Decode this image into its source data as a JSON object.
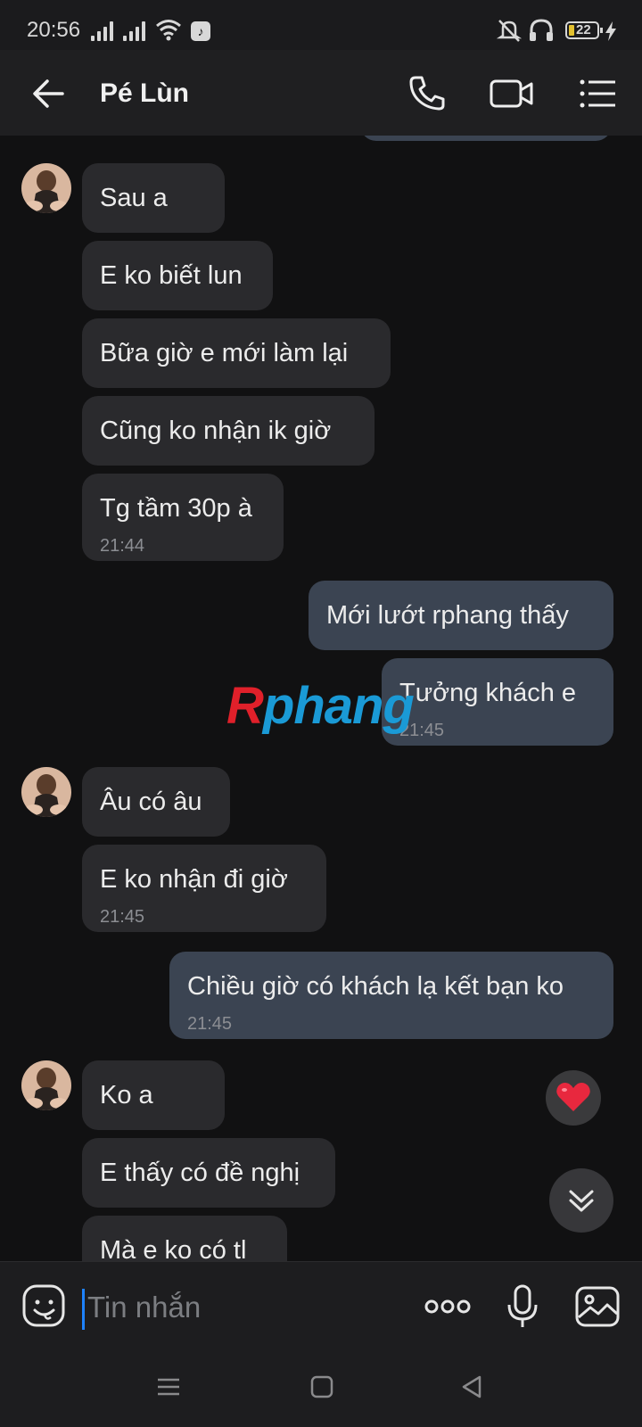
{
  "status_bar": {
    "time": "20:56",
    "battery": "22",
    "icons": [
      "signal-icon",
      "signal-icon",
      "wifi-icon",
      "tiktok-icon",
      "mute-icon",
      "headphones-icon",
      "battery-icon",
      "charging-icon"
    ]
  },
  "header": {
    "contact_name": "Pé Lùn",
    "icons": [
      "back-arrow-icon",
      "phone-icon",
      "video-call-icon",
      "menu-list-icon"
    ]
  },
  "messages": [
    {
      "side": "in",
      "text": "Sau a"
    },
    {
      "side": "in",
      "text": "E ko biết lun"
    },
    {
      "side": "in",
      "text": "Bữa giờ e mới làm lại"
    },
    {
      "side": "in",
      "text": "Cũng ko nhận ik giờ"
    },
    {
      "side": "in",
      "text": "Tg tầm 30p à",
      "time": "21:44"
    },
    {
      "side": "out",
      "text": "Mới lướt rphang thấy"
    },
    {
      "side": "out",
      "text": "Tưởng khách e",
      "time": "21:45"
    },
    {
      "side": "in",
      "text": "Âu có âu"
    },
    {
      "side": "in",
      "text": "E ko nhận đi giờ",
      "time": "21:45"
    },
    {
      "side": "out",
      "text": "Chiều giờ có khách lạ kết bạn ko",
      "time": "21:45"
    },
    {
      "side": "in",
      "text": "Ko a"
    },
    {
      "side": "in",
      "text": "E thấy có đề nghị"
    },
    {
      "side": "in",
      "text": "Mà e ko có tl"
    }
  ],
  "watermark": {
    "first": "R",
    "rest": "phang"
  },
  "input": {
    "placeholder": "Tin nhắn"
  },
  "colors": {
    "background": "#111112",
    "incoming_bubble": "#2a2a2d",
    "outgoing_bubble": "#3b4452",
    "reaction_heart": "#e8283e",
    "caret": "#1e82ff"
  }
}
